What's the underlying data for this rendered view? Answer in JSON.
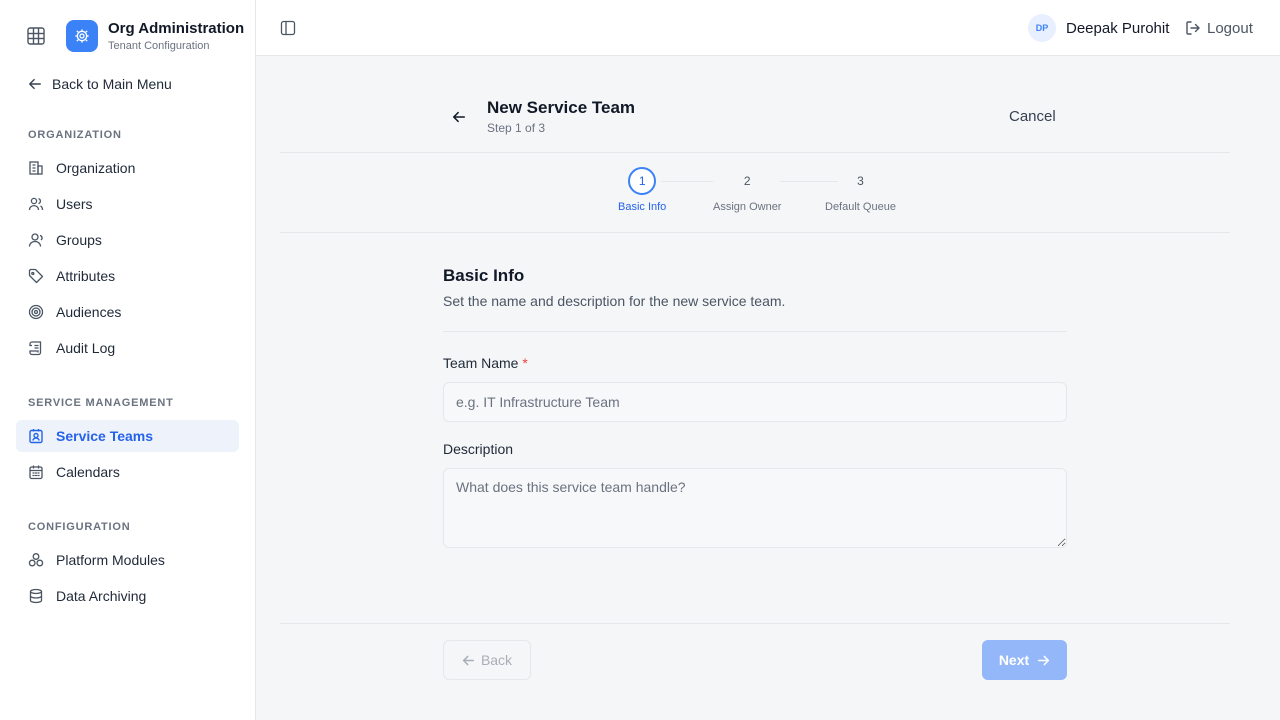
{
  "app": {
    "title": "Org Administration",
    "subtitle": "Tenant Configuration"
  },
  "sidebar": {
    "back_label": "Back to Main Menu",
    "sections": [
      {
        "title": "ORGANIZATION",
        "items": [
          {
            "label": "Organization",
            "icon": "building-icon"
          },
          {
            "label": "Users",
            "icon": "users-icon"
          },
          {
            "label": "Groups",
            "icon": "user-group-icon"
          },
          {
            "label": "Attributes",
            "icon": "tag-icon"
          },
          {
            "label": "Audiences",
            "icon": "target-icon"
          },
          {
            "label": "Audit Log",
            "icon": "scroll-icon"
          }
        ]
      },
      {
        "title": "SERVICE MANAGEMENT",
        "items": [
          {
            "label": "Service Teams",
            "icon": "contact-icon",
            "active": true
          },
          {
            "label": "Calendars",
            "icon": "calendar-icon"
          }
        ]
      },
      {
        "title": "CONFIGURATION",
        "items": [
          {
            "label": "Platform Modules",
            "icon": "boxes-icon"
          },
          {
            "label": "Data Archiving",
            "icon": "database-icon"
          }
        ]
      }
    ]
  },
  "header": {
    "user_initials": "DP",
    "user_name": "Deepak Purohit",
    "logout_label": "Logout"
  },
  "page": {
    "title": "New Service Team",
    "step_text": "Step 1 of 3",
    "cancel_label": "Cancel"
  },
  "stepper": {
    "steps": [
      {
        "number": "1",
        "label": "Basic Info",
        "active": true
      },
      {
        "number": "2",
        "label": "Assign Owner"
      },
      {
        "number": "3",
        "label": "Default Queue"
      }
    ]
  },
  "form": {
    "heading": "Basic Info",
    "description": "Set the name and description for the new service team.",
    "team_name_label": "Team Name",
    "required_mark": "*",
    "team_name_placeholder": "e.g. IT Infrastructure Team",
    "team_name_value": "",
    "description_label": "Description",
    "description_placeholder": "What does this service team handle?",
    "description_value": ""
  },
  "footer": {
    "back_label": "Back",
    "next_label": "Next"
  },
  "colors": {
    "accent": "#3b82f6",
    "active_nav_bg": "#eef2fb",
    "next_button": "#93b7f8",
    "required": "#ef4444"
  }
}
